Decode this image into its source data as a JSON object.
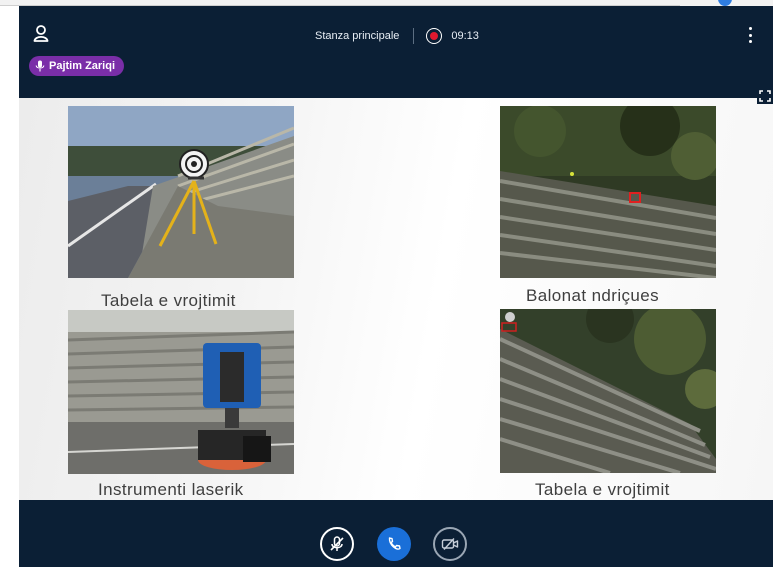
{
  "header": {
    "participant_name": "Pajtim Zariqi",
    "room_name": "Stanza principale",
    "timer": "09:13"
  },
  "slide": {
    "captions": {
      "top_left": "Tabela e vrojtimit",
      "top_right": "Balonat ndriçues",
      "bottom_left": "Instrumenti laserik",
      "bottom_right": "Tabela e vrojtimit"
    }
  },
  "colors": {
    "background": "#0b1f35",
    "badge": "#7a2ea8",
    "record": "#e0192f",
    "call_button": "#1a6fd8"
  },
  "icons": {
    "participant": "user-icon",
    "badge": "microphone-icon",
    "record": "record-icon",
    "menu": "more-vertical-icon",
    "fullscreen": "expand-icon",
    "mute": "mic-off-icon",
    "call": "phone-icon",
    "camera": "camera-off-icon"
  }
}
